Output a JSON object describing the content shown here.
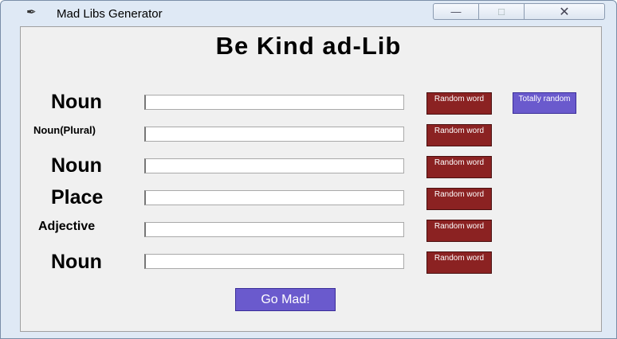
{
  "window": {
    "title": "Mad Libs Generator",
    "app_icon": "feather-icon",
    "controls": {
      "minimize": "minimize-icon",
      "maximize": "maximize-icon",
      "close": "close-icon"
    }
  },
  "heading": "Be Kind ad-Lib",
  "rows": [
    {
      "label": "Noun",
      "value": "",
      "button": "Random word"
    },
    {
      "label": "Noun(Plural)",
      "value": "",
      "button": "Random word"
    },
    {
      "label": "Noun",
      "value": "",
      "button": "Random word"
    },
    {
      "label": "Place",
      "value": "",
      "button": "Random word"
    },
    {
      "label": "Adjective",
      "value": "",
      "button": "Random word"
    },
    {
      "label": "Noun",
      "value": "",
      "button": "Random word"
    }
  ],
  "totally_random_button": "Totally random",
  "go_button": "Go Mad!",
  "colors": {
    "random_button_bg": "#8b2222",
    "accent_button_bg": "#6a5acd"
  }
}
